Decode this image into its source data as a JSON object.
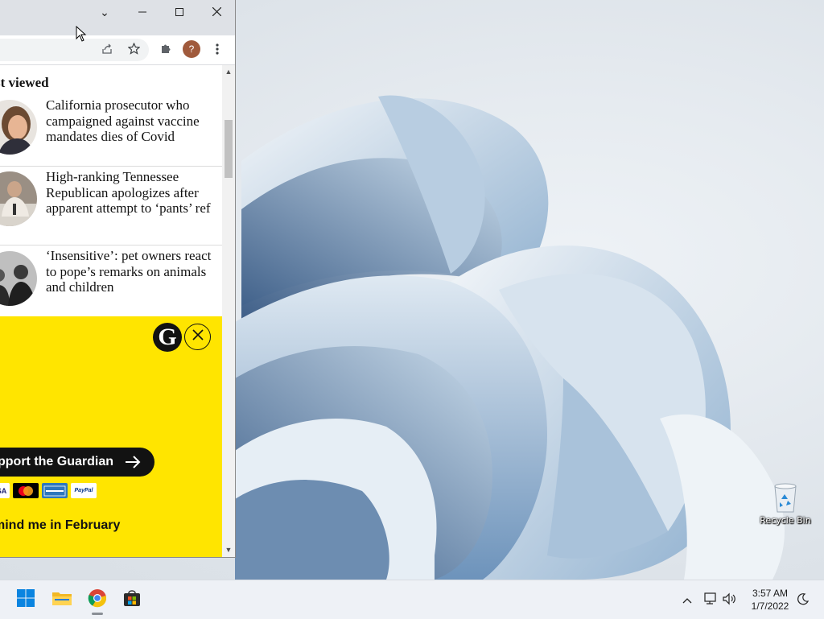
{
  "window": {
    "controls": {
      "tab_search": "⌄",
      "minimize": "—",
      "maximize": "☐",
      "close": "✕"
    },
    "profile_initial": "?"
  },
  "page": {
    "section_heading": "st viewed",
    "articles": [
      {
        "headline": "California prosecutor who campaigned against vaccine mandates dies of Covid"
      },
      {
        "headline": "High-ranking Tennessee Republican apologizes after apparent attempt to ‘pants’ ref"
      },
      {
        "headline": "‘Insensitive’: pet owners react to pope’s remarks on animals and children"
      }
    ],
    "banner": {
      "logo_letter": "G",
      "support_button": "pport the Guardian",
      "payments": [
        "SA",
        "mastercard",
        "AMERICAN EXPRESS",
        "PayPal"
      ],
      "remind_link": "mind me in February"
    }
  },
  "desktop": {
    "recycle_bin_label": "Recycle Bin"
  },
  "taskbar": {
    "apps": [
      "start",
      "file-explorer",
      "chrome",
      "microsoft-store"
    ],
    "clock_time": "3:57 AM",
    "clock_date": "1/7/2022"
  },
  "colors": {
    "banner_yellow": "#ffe500",
    "guardian_black": "#121212",
    "titlebar": "#dee1e6",
    "taskbar": "#eef1f6"
  }
}
